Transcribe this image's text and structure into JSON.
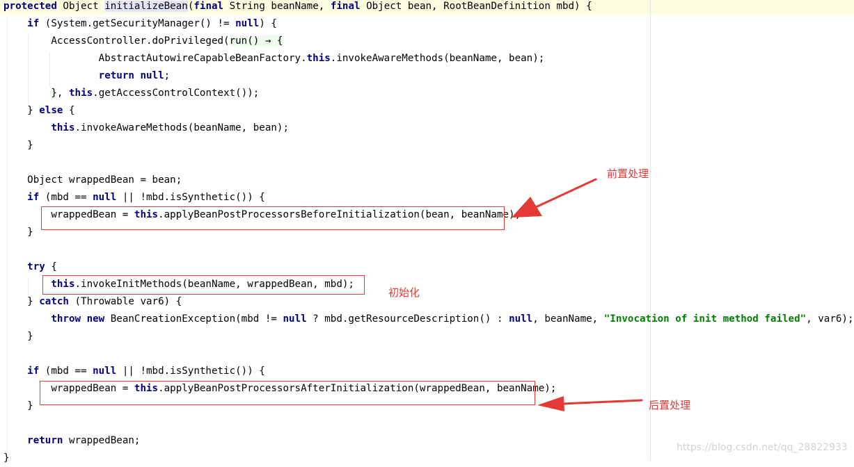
{
  "code": {
    "lines": [
      [
        {
          "t": "protected",
          "c": "kw"
        },
        {
          "t": " Object "
        },
        {
          "t": "initializeBean",
          "c": "meth-hl"
        },
        {
          "t": "("
        },
        {
          "t": "final",
          "c": "kw"
        },
        {
          "t": " String beanName, "
        },
        {
          "t": "final",
          "c": "kw"
        },
        {
          "t": " Object bean, RootBeanDefinition mbd) {"
        }
      ],
      [
        {
          "t": "    "
        },
        {
          "t": "if",
          "c": "kw"
        },
        {
          "t": " (System.getSecurityManager() != "
        },
        {
          "t": "null",
          "c": "kw"
        },
        {
          "t": ") {"
        }
      ],
      [
        {
          "t": "        AccessController.doPrivileged("
        },
        {
          "t": "run() → {",
          "c": "lambda-hl"
        }
      ],
      [
        {
          "t": "                AbstractAutowireCapableBeanFactory."
        },
        {
          "t": "this",
          "c": "kw"
        },
        {
          "t": ".invokeAwareMethods(beanName, bean);"
        }
      ],
      [
        {
          "t": "                "
        },
        {
          "t": "return null",
          "c": "kw"
        },
        {
          "t": ";"
        }
      ],
      [
        {
          "t": "        "
        },
        {
          "t": "}",
          "c": "brace-hl"
        },
        {
          "t": ", "
        },
        {
          "t": "this",
          "c": "kw"
        },
        {
          "t": ".getAccessControlContext());"
        }
      ],
      [
        {
          "t": "    } "
        },
        {
          "t": "else",
          "c": "kw"
        },
        {
          "t": " {"
        }
      ],
      [
        {
          "t": "        "
        },
        {
          "t": "this",
          "c": "kw"
        },
        {
          "t": ".invokeAwareMethods(beanName, bean);"
        }
      ],
      [
        {
          "t": "    }"
        }
      ],
      [
        {
          "t": ""
        }
      ],
      [
        {
          "t": "    Object wrappedBean = bean;"
        }
      ],
      [
        {
          "t": "    "
        },
        {
          "t": "if",
          "c": "kw"
        },
        {
          "t": " (mbd == "
        },
        {
          "t": "null",
          "c": "kw"
        },
        {
          "t": " || !mbd.isSynthetic()) {"
        }
      ],
      [
        {
          "t": "        wrappedBean = "
        },
        {
          "t": "this",
          "c": "kw"
        },
        {
          "t": ".applyBeanPostProcessorsBeforeInitialization(bean, beanName);"
        }
      ],
      [
        {
          "t": "    }"
        }
      ],
      [
        {
          "t": ""
        }
      ],
      [
        {
          "t": "    "
        },
        {
          "t": "try",
          "c": "kw"
        },
        {
          "t": " {"
        }
      ],
      [
        {
          "t": "        "
        },
        {
          "t": "this",
          "c": "kw"
        },
        {
          "t": ".invokeInitMethods(beanName, wrappedBean, mbd);"
        }
      ],
      [
        {
          "t": "    } "
        },
        {
          "t": "catch",
          "c": "kw"
        },
        {
          "t": " (Throwable var6) {"
        }
      ],
      [
        {
          "t": "        "
        },
        {
          "t": "throw new",
          "c": "kw"
        },
        {
          "t": " BeanCreationException(mbd != "
        },
        {
          "t": "null",
          "c": "kw"
        },
        {
          "t": " ? mbd.getResourceDescription() : "
        },
        {
          "t": "null",
          "c": "kw"
        },
        {
          "t": ", beanName, "
        },
        {
          "t": "\"Invocation of init method failed\"",
          "c": "str"
        },
        {
          "t": ", var6);"
        }
      ],
      [
        {
          "t": "    }"
        }
      ],
      [
        {
          "t": ""
        }
      ],
      [
        {
          "t": "    "
        },
        {
          "t": "if",
          "c": "kw"
        },
        {
          "t": " (mbd == "
        },
        {
          "t": "null",
          "c": "kw"
        },
        {
          "t": " || !mbd.isSynthetic()) {"
        }
      ],
      [
        {
          "t": "        wrappedBean = "
        },
        {
          "t": "this",
          "c": "kw"
        },
        {
          "t": ".applyBeanPostProcessorsAfterInitialization(wrappedBean, beanName);"
        }
      ],
      [
        {
          "t": "    }"
        }
      ],
      [
        {
          "t": ""
        }
      ],
      [
        {
          "t": "    "
        },
        {
          "t": "return",
          "c": "kw"
        },
        {
          "t": " wrappedBean;"
        }
      ],
      [
        {
          "t": "}"
        }
      ]
    ]
  },
  "annotations": {
    "pre_processing": "前置处理",
    "initialization": "初始化",
    "post_processing": "后置处理",
    "color": "#e53935"
  },
  "watermark": "https://blog.csdn.net/qq_28822933"
}
